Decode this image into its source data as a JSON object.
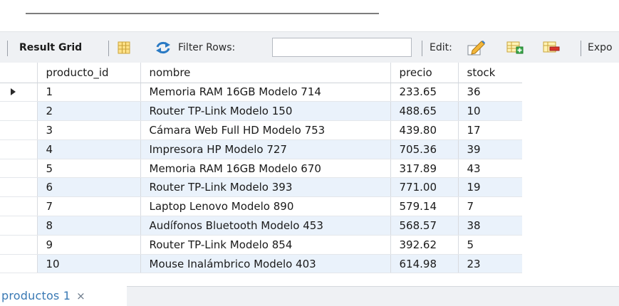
{
  "toolbar": {
    "result_grid_label": "Result Grid",
    "filter_label": "Filter Rows:",
    "filter_value": "",
    "edit_label": "Edit:",
    "export_label": "Expo"
  },
  "grid": {
    "columns": [
      "producto_id",
      "nombre",
      "precio",
      "stock"
    ],
    "rows": [
      {
        "producto_id": "1",
        "nombre": "Memoria RAM 16GB Modelo 714",
        "precio": "233.65",
        "stock": "36"
      },
      {
        "producto_id": "2",
        "nombre": "Router TP-Link Modelo 150",
        "precio": "488.65",
        "stock": "10"
      },
      {
        "producto_id": "3",
        "nombre": "Cámara Web Full HD Modelo 753",
        "precio": "439.80",
        "stock": "17"
      },
      {
        "producto_id": "4",
        "nombre": "Impresora HP Modelo 727",
        "precio": "705.36",
        "stock": "39"
      },
      {
        "producto_id": "5",
        "nombre": "Memoria RAM 16GB Modelo 670",
        "precio": "317.89",
        "stock": "43"
      },
      {
        "producto_id": "6",
        "nombre": "Router TP-Link Modelo 393",
        "precio": "771.00",
        "stock": "19"
      },
      {
        "producto_id": "7",
        "nombre": "Laptop Lenovo Modelo 890",
        "precio": "579.14",
        "stock": "7"
      },
      {
        "producto_id": "8",
        "nombre": "Audífonos Bluetooth Modelo 453",
        "precio": "568.57",
        "stock": "38"
      },
      {
        "producto_id": "9",
        "nombre": "Router TP-Link Modelo 854",
        "precio": "392.62",
        "stock": "5"
      },
      {
        "producto_id": "10",
        "nombre": "Mouse Inalámbrico Modelo 403",
        "precio": "614.98",
        "stock": "23"
      }
    ]
  },
  "tabs": [
    {
      "label": "productos 1",
      "close": "×"
    }
  ],
  "icons": {
    "grid": "grid-view-icon",
    "refresh": "refresh-icon",
    "edit": "edit-pencil-icon",
    "add_row": "add-row-icon",
    "delete_row": "delete-row-icon",
    "row_pointer": "row-pointer-icon"
  },
  "colors": {
    "toolbar_bg": "#eff1f4",
    "alt_row_bg": "#eaf2fb",
    "tab_text": "#3979b4",
    "refresh_blue": "#2a7ac4"
  }
}
